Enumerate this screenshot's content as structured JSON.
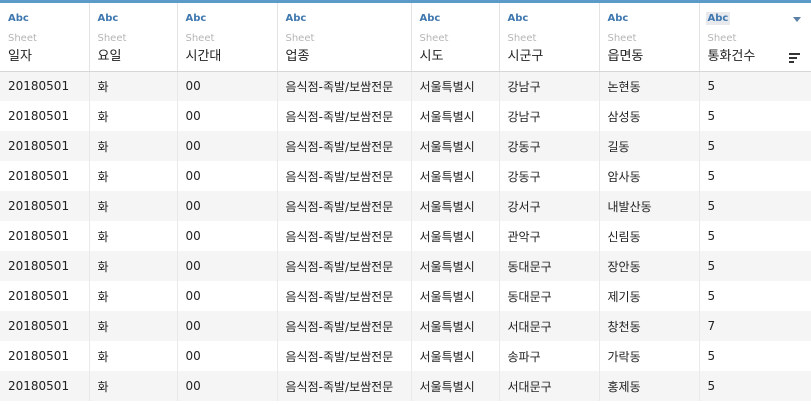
{
  "columns": [
    {
      "type": "Abc",
      "source": "Sheet",
      "name": "일자"
    },
    {
      "type": "Abc",
      "source": "Sheet",
      "name": "요일"
    },
    {
      "type": "Abc",
      "source": "Sheet",
      "name": "시간대"
    },
    {
      "type": "Abc",
      "source": "Sheet",
      "name": "업종"
    },
    {
      "type": "Abc",
      "source": "Sheet",
      "name": "시도"
    },
    {
      "type": "Abc",
      "source": "Sheet",
      "name": "시군구"
    },
    {
      "type": "Abc",
      "source": "Sheet",
      "name": "읍면동"
    },
    {
      "type": "Abc",
      "source": "Sheet",
      "name": "통화건수"
    }
  ],
  "rows": [
    [
      "20180501",
      "화",
      "00",
      "음식점-족발/보쌈전문",
      "서울특별시",
      "강남구",
      "논현동",
      "5"
    ],
    [
      "20180501",
      "화",
      "00",
      "음식점-족발/보쌈전문",
      "서울특별시",
      "강남구",
      "삼성동",
      "5"
    ],
    [
      "20180501",
      "화",
      "00",
      "음식점-족발/보쌈전문",
      "서울특별시",
      "강동구",
      "길동",
      "5"
    ],
    [
      "20180501",
      "화",
      "00",
      "음식점-족발/보쌈전문",
      "서울특별시",
      "강동구",
      "암사동",
      "5"
    ],
    [
      "20180501",
      "화",
      "00",
      "음식점-족발/보쌈전문",
      "서울특별시",
      "강서구",
      "내발산동",
      "5"
    ],
    [
      "20180501",
      "화",
      "00",
      "음식점-족발/보쌈전문",
      "서울특별시",
      "관악구",
      "신림동",
      "5"
    ],
    [
      "20180501",
      "화",
      "00",
      "음식점-족발/보쌈전문",
      "서울특별시",
      "동대문구",
      "장안동",
      "5"
    ],
    [
      "20180501",
      "화",
      "00",
      "음식점-족발/보쌈전문",
      "서울특별시",
      "동대문구",
      "제기동",
      "5"
    ],
    [
      "20180501",
      "화",
      "00",
      "음식점-족발/보쌈전문",
      "서울특별시",
      "서대문구",
      "창천동",
      "7"
    ],
    [
      "20180501",
      "화",
      "00",
      "음식점-족발/보쌈전문",
      "서울특별시",
      "송파구",
      "가락동",
      "5"
    ],
    [
      "20180501",
      "화",
      "00",
      "음식점-족발/보쌈전문",
      "서울특별시",
      "서대문구",
      "홍제동",
      "5"
    ]
  ],
  "icons": {
    "column_menu": "chevron-down-icon",
    "sort": "sort-descending-icon"
  },
  "colors": {
    "accent": "#5b9bc8",
    "type_text": "#3f78b0",
    "stripe": "#f5f5f5"
  }
}
